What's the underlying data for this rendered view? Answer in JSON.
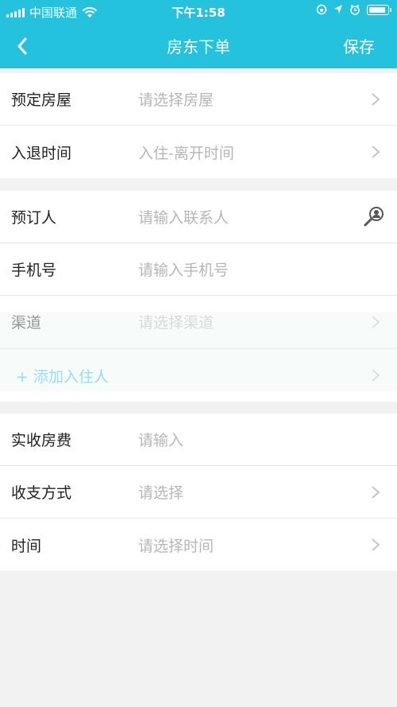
{
  "status_bar": {
    "carrier": "中国联通",
    "time": "下午1:58"
  },
  "nav": {
    "title": "房东下单",
    "save_label": "保存"
  },
  "group1": [
    {
      "label": "预定房屋",
      "placeholder": "请选择房屋"
    },
    {
      "label": "入退时间",
      "placeholder": "入住-离开时间"
    }
  ],
  "group2": [
    {
      "label": "预订人",
      "placeholder": "请输入联系人"
    },
    {
      "label": "手机号",
      "placeholder": "请输入手机号"
    },
    {
      "label": "渠道",
      "placeholder": "请选择渠道"
    }
  ],
  "add_resident_label": "+ 添加入住人",
  "group3": [
    {
      "label": "实收房费",
      "placeholder": "请输入"
    },
    {
      "label": "收支方式",
      "placeholder": "请选择"
    },
    {
      "label": "时间",
      "placeholder": "请选择时间"
    }
  ],
  "colors": {
    "accent": "#24c2dd",
    "background": "#f2f2f2",
    "placeholder": "#b6b6b6"
  },
  "icons": {
    "back": "chevron-left-icon",
    "chevron": "chevron-right-icon",
    "contact": "contact-picker-icon"
  }
}
